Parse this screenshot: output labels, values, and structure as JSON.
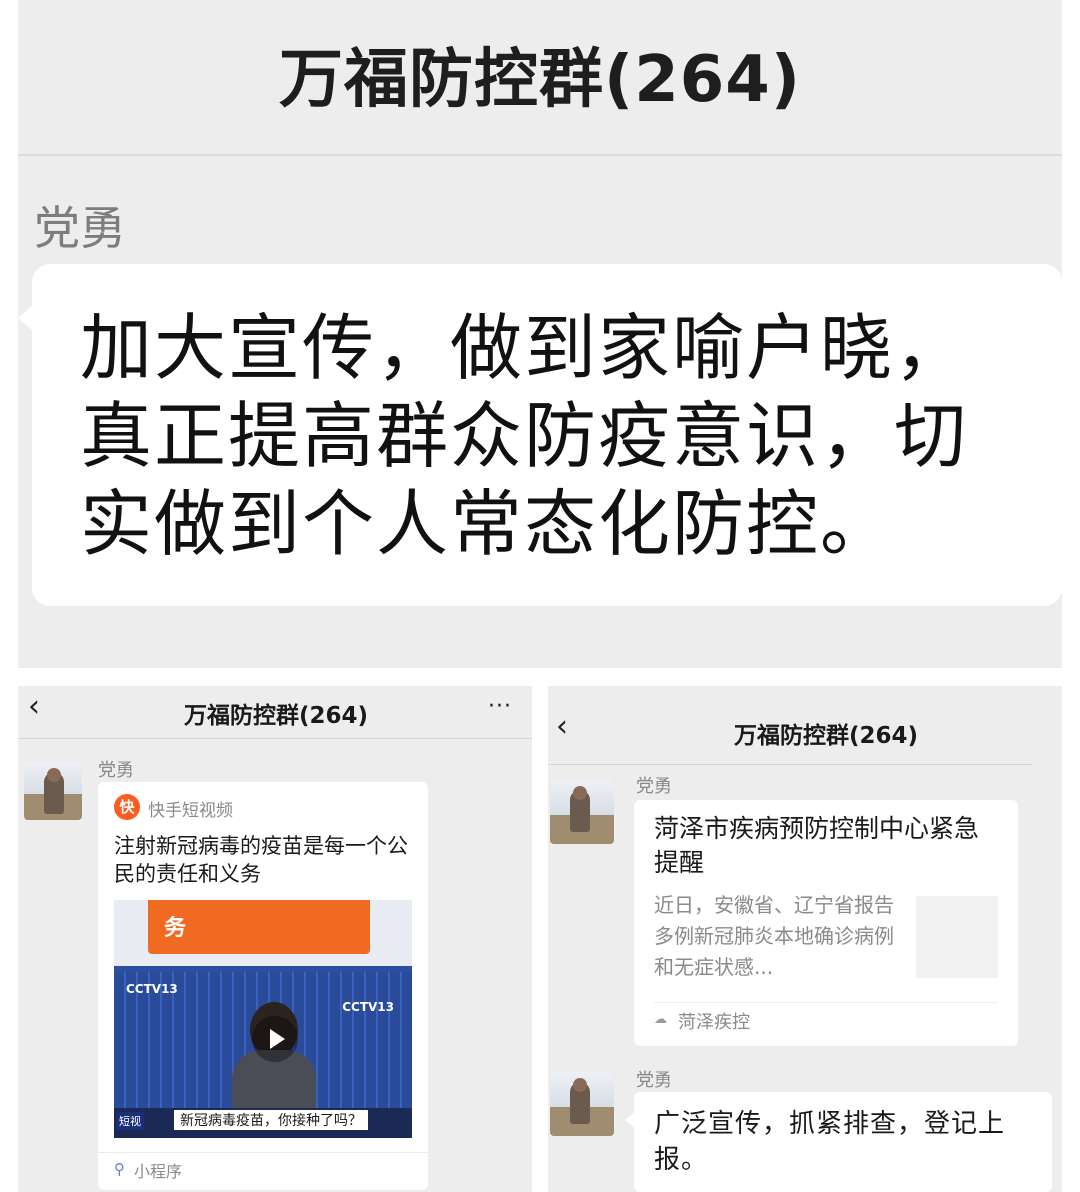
{
  "top": {
    "title": "万福防控群(264)",
    "sender": "党勇",
    "message": "加大宣传，做到家喻户晓，真正提高群众防疫意识，切实做到个人常态化防控。"
  },
  "left_screen": {
    "back_icon": "chevron-left-icon",
    "back_glyph": "‹",
    "title": "万福防控群(264)",
    "more_glyph": "···",
    "sender": "党勇",
    "card": {
      "app_name": "快手短视频",
      "title": "注射新冠病毒的疫苗是每一个公民的责任和义务",
      "thumb_banner": "务",
      "thumb_logo": "CCTV13",
      "thumb_tag": "短视",
      "thumb_caption": "新冠病毒疫苗，你接种了吗？",
      "source_label": "小程序"
    }
  },
  "right_screen": {
    "back_glyph": "‹",
    "title": "万福防控群(264)",
    "sender1": "党勇",
    "article": {
      "title": "菏泽市疾病预防控制中心紧急提醒",
      "desc": "近日，安徽省、辽宁省报告多例新冠肺炎本地确诊病例和无症状感...",
      "source": "菏泽疾控"
    },
    "sender2": "党勇",
    "message": "广泛宣传，抓紧排查，登记上报。"
  },
  "colors": {
    "chat_bg": "#ededed",
    "bubble_bg": "#ffffff",
    "brand_orange": "#ff5a1f"
  }
}
